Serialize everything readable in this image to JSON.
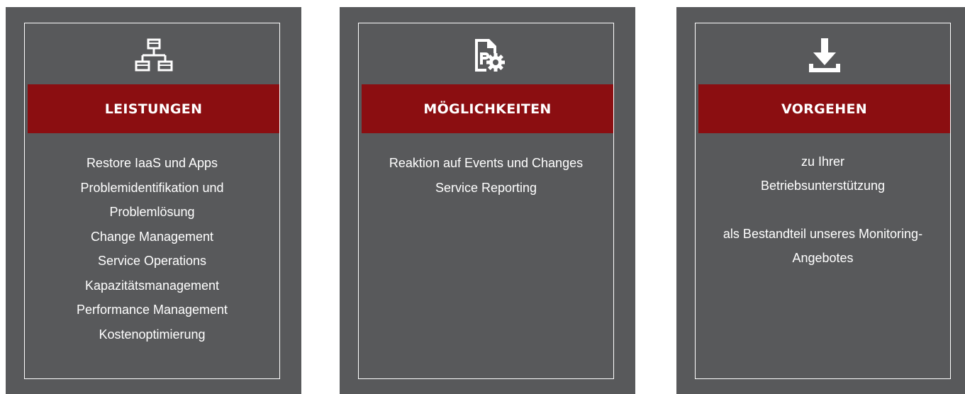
{
  "cards": [
    {
      "icon": "network-hierarchy-icon",
      "title": "LEISTUNGEN",
      "items": [
        "Restore IaaS und Apps",
        "Problemidentifikation und",
        "Problemlösung",
        "Change Management",
        "Service Operations",
        "Kapazitätsmanagement",
        "Performance Management",
        "Kostenoptimierung"
      ]
    },
    {
      "icon": "document-gear-icon",
      "title": "MÖGLICHKEITEN",
      "items": [
        "Reaktion auf Events und Changes",
        "Service Reporting"
      ]
    },
    {
      "icon": "download-icon",
      "title": "VORGEHEN",
      "items": [
        "zu Ihrer",
        "Betriebsunterstützung",
        "",
        "als Bestandteil unseres Monitoring-",
        "Angebotes"
      ]
    }
  ],
  "colors": {
    "card_background": "#58595b",
    "banner_background": "#8b0e11",
    "text": "#ffffff"
  }
}
